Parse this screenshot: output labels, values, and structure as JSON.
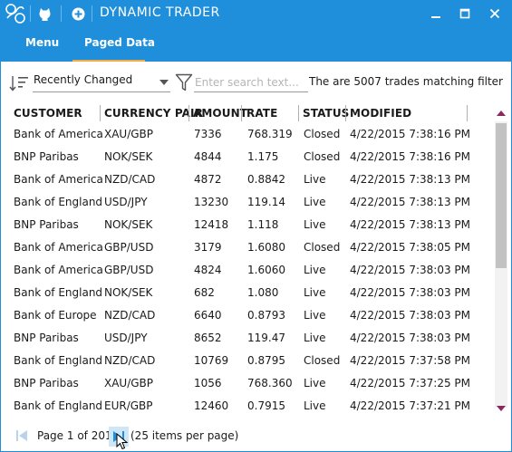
{
  "window": {
    "title": "DYNAMIC TRADER",
    "accent": "#1f8fdc",
    "tab_underline": "#f3a94a"
  },
  "titlebar_icons": [
    "app-logo-icon",
    "github-icon",
    "add-circle-icon",
    "minimize-icon",
    "maximize-icon",
    "close-icon"
  ],
  "tabs": [
    {
      "label": "Menu"
    },
    {
      "label": "Paged Data"
    }
  ],
  "filter": {
    "sort_value": "Recently Changed",
    "search_placeholder": "Enter search text...",
    "match_text": "The are 5007 trades matching filter"
  },
  "columns": [
    "CUSTOMER",
    "CURRENCY PAIR",
    "AMOUNT",
    "RATE",
    "STATUS",
    "MODIFIED"
  ],
  "rows": [
    [
      "Bank of America",
      "XAU/GBP",
      "7336",
      "768.319",
      "Closed",
      "4/22/2015 7:38:16 PM"
    ],
    [
      "BNP Paribas",
      "NOK/SEK",
      "4844",
      "1.175",
      "Closed",
      "4/22/2015 7:38:16 PM"
    ],
    [
      "Bank of America",
      "NZD/CAD",
      "4872",
      "0.8842",
      "Live",
      "4/22/2015 7:38:13 PM"
    ],
    [
      "Bank of England",
      "USD/JPY",
      "13230",
      "119.14",
      "Live",
      "4/22/2015 7:38:13 PM"
    ],
    [
      "BNP Paribas",
      "NOK/SEK",
      "12418",
      "1.118",
      "Live",
      "4/22/2015 7:38:13 PM"
    ],
    [
      "Bank of America",
      "GBP/USD",
      "3179",
      "1.6080",
      "Closed",
      "4/22/2015 7:38:05 PM"
    ],
    [
      "Bank of America",
      "GBP/USD",
      "4824",
      "1.6060",
      "Live",
      "4/22/2015 7:38:03 PM"
    ],
    [
      "Bank of England",
      "NOK/SEK",
      "682",
      "1.080",
      "Live",
      "4/22/2015 7:38:03 PM"
    ],
    [
      "Bank of Europe",
      "NZD/CAD",
      "6640",
      "0.8793",
      "Live",
      "4/22/2015 7:38:03 PM"
    ],
    [
      "BNP Paribas",
      "USD/JPY",
      "8652",
      "119.47",
      "Live",
      "4/22/2015 7:38:03 PM"
    ],
    [
      "Bank of England",
      "NZD/CAD",
      "10769",
      "0.8795",
      "Closed",
      "4/22/2015 7:37:58 PM"
    ],
    [
      "BNP Paribas",
      "XAU/GBP",
      "1056",
      "768.360",
      "Live",
      "4/22/2015 7:37:25 PM"
    ],
    [
      "Bank of England",
      "EUR/GBP",
      "12460",
      "0.7915",
      "Live",
      "4/22/2015 7:37:21 PM"
    ]
  ],
  "pager": {
    "page_label": "Page 1 of 201",
    "per_page": "(25 items per page)"
  }
}
